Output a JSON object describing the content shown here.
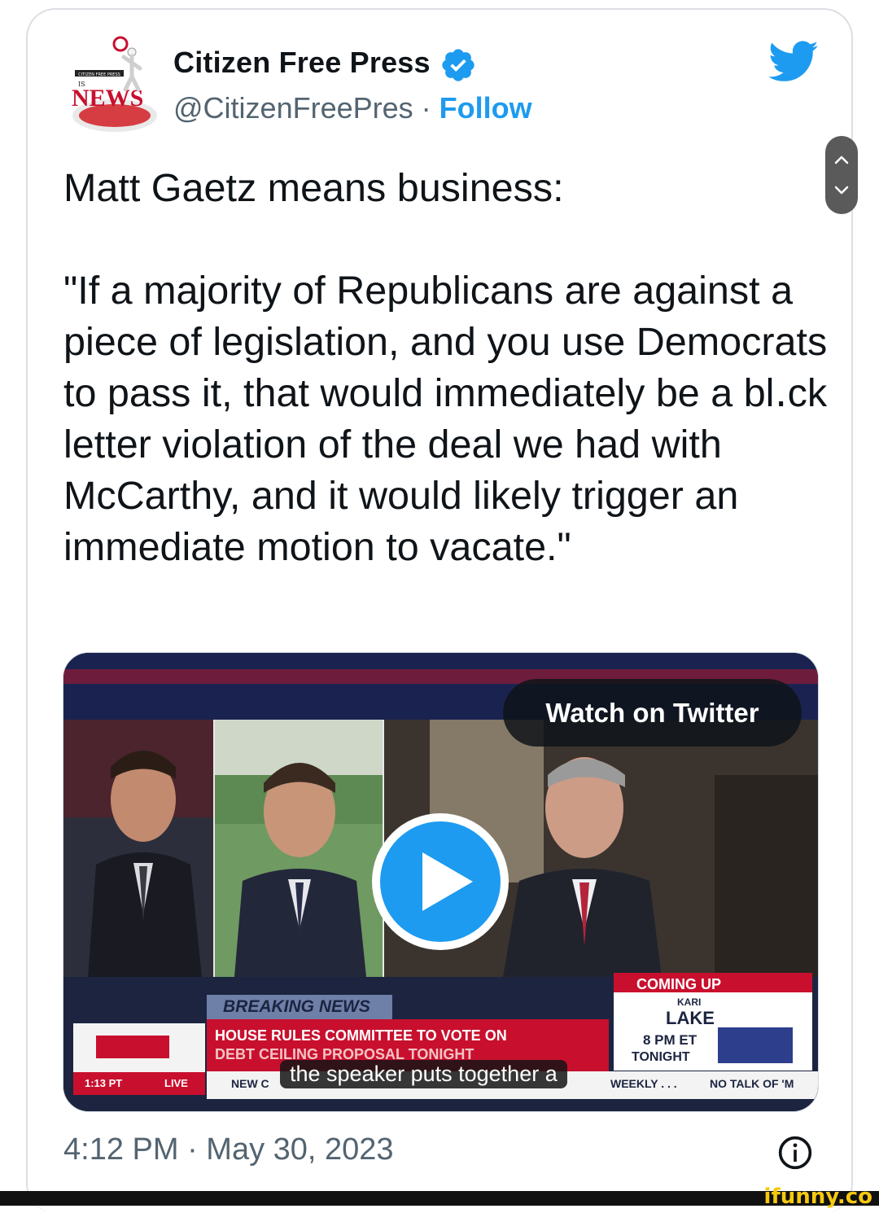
{
  "author": {
    "name": "Citizen Free Press",
    "handle": "@CitizenFreePres",
    "separator": "·",
    "follow_label": "Follow",
    "avatar_text": "NEWS",
    "avatar_small_text": "CITIZEN FREE PRESS",
    "avatar_is_text": "IS"
  },
  "tweet": {
    "text": "Matt Gaetz means business:\n\n\"If a majority of Republicans are against a piece of legislation, and you use Democrats to pass it, that would immediately be a bl․ck letter violation of the deal we had with McCarthy, and it would likely trigger an immediate motion to vacate.\""
  },
  "media": {
    "watch_label": "Watch on Twitter",
    "play_icon": "play-icon",
    "breaking_label": "BREAKING NEWS",
    "headline_1": "HOUSE RULES COMMITTEE TO VOTE ON",
    "headline_2": "DEBT CEILING PROPOSAL TONIGHT",
    "time_label": "1:13 PT",
    "live_label": "LIVE",
    "ticker_prefix": "NEW C",
    "caption": "the speaker puts together a",
    "ticker_right": "WEEKLY . . .",
    "ticker_far_right": "NO TALK OF 'M",
    "coming_up": "COMING UP",
    "kari": "KARI",
    "lake": "LAKE",
    "time_pm": "8 PM ET",
    "tonight": "TONIGHT"
  },
  "meta": {
    "timestamp": "4:12 PM · May 30, 2023"
  },
  "watermark": "ifunny.co",
  "colors": {
    "twitter_blue": "#1d9bf0",
    "text": "#0f1419",
    "muted": "#536471",
    "news_red": "#c8102e",
    "news_navy": "#1c2440"
  }
}
